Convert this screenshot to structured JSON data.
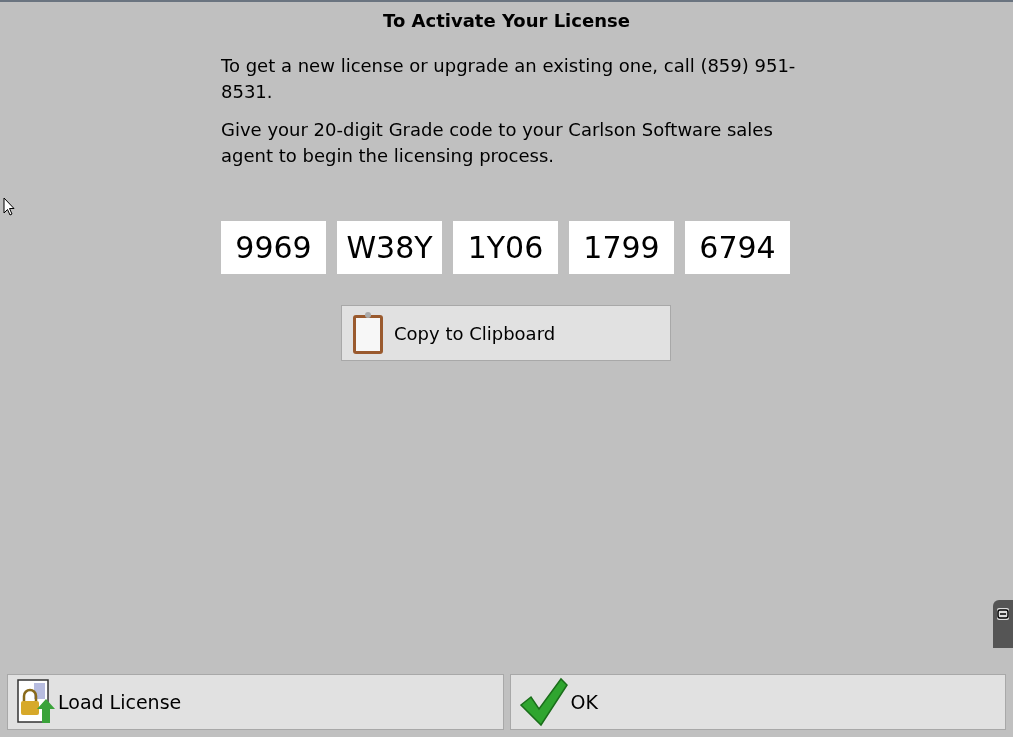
{
  "title": "To Activate Your License",
  "paragraphs": [
    "To get a new license or upgrade an existing one, call (859) 951-8531.",
    "Give your 20-digit Grade code to your Carlson Software sales agent to begin the licensing process."
  ],
  "code_groups": [
    "9969",
    "W38Y",
    "1Y06",
    "1799",
    "6794"
  ],
  "copy_button": {
    "label": "Copy to Clipboard"
  },
  "buttons": [
    {
      "kind": "load",
      "label": "Load License"
    },
    {
      "kind": "ok",
      "label": "OK"
    }
  ]
}
